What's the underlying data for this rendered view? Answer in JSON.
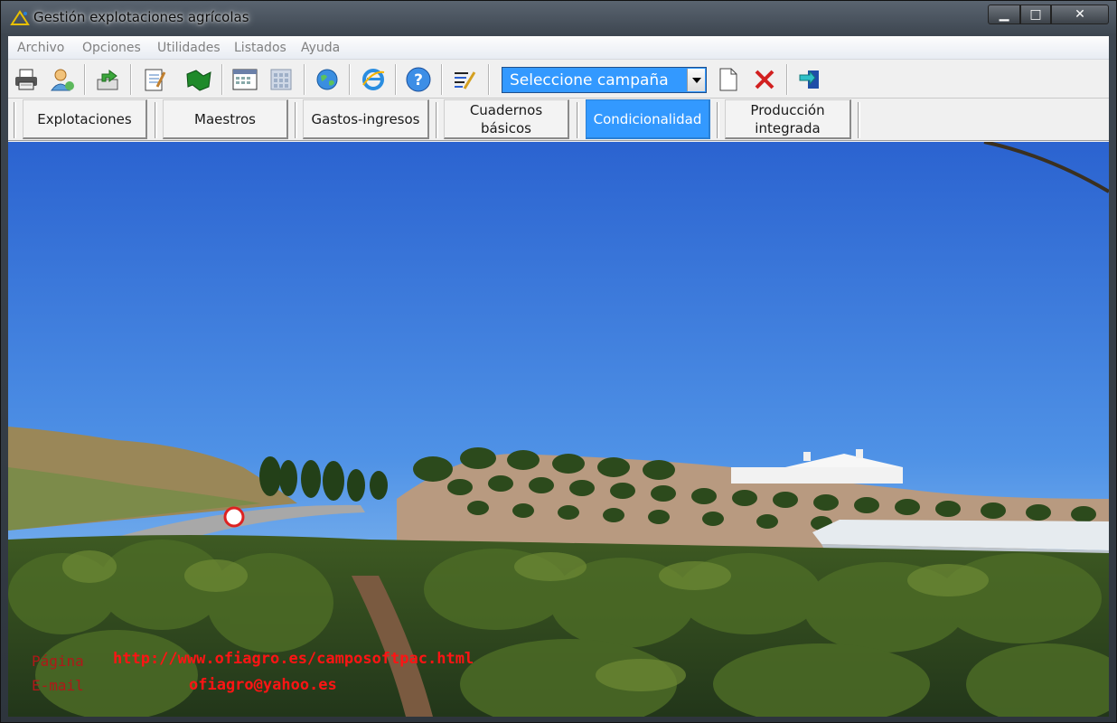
{
  "window": {
    "title": "Gestión explotaciones agrícolas",
    "controls": {
      "minimize": "▁",
      "maximize": "□",
      "close": "✕"
    }
  },
  "menu": [
    "Archivo",
    "Opciones",
    "Utilidades",
    "Listados",
    "Ayuda"
  ],
  "toolbar": {
    "icons": [
      "printer-icon",
      "user-icon",
      "export-icon",
      "notebook-icon",
      "map-icon",
      "calendar-icon",
      "calculator-icon",
      "globe-icon",
      "internet-explorer-icon",
      "help-icon",
      "edit-document-icon"
    ],
    "campaign_select": "Seleccione campaña",
    "after_select_icons": [
      "new-document-icon",
      "delete-icon",
      "exit-door-icon"
    ]
  },
  "tabs": [
    {
      "label": "Explotaciones",
      "active": false
    },
    {
      "label": "Maestros",
      "active": false
    },
    {
      "label": "Gastos-ingresos",
      "active": false
    },
    {
      "label": "Cuadernos\nbásicos",
      "active": false
    },
    {
      "label": "Condicionalidad",
      "active": true
    },
    {
      "label": "Producción\nintegrada",
      "active": false
    }
  ],
  "footer_info": {
    "web_label": "Página",
    "web_value": "http://www.ofiagro.es/camposoftpac.html",
    "email_label": "E-mail",
    "email_value": "ofiagro@yahoo.es"
  },
  "colors": {
    "accent": "#3399ff",
    "link_red": "#ff1414"
  }
}
